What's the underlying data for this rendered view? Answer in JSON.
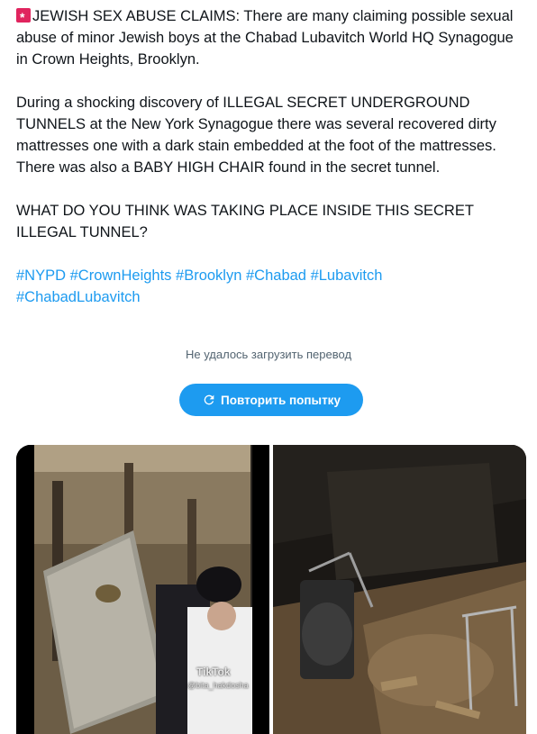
{
  "post": {
    "paragraph1": "JEWISH SEX ABUSE CLAIMS: There are many claiming possible sexual abuse of minor Jewish boys at the Chabad Lubavitch World HQ Synagogue in Crown Heights, Brooklyn.",
    "paragraph2": "During a shocking discovery of ILLEGAL SECRET UNDERGROUND TUNNELS at the New York Synagogue there was several recovered dirty mattresses one with a dark stain embedded at the foot of the mattresses. There was also a BABY HIGH CHAIR found in the secret tunnel.",
    "paragraph3": "WHAT DO YOU THINK WAS TAKING PLACE INSIDE THIS SECRET ILLEGAL TUNNEL?",
    "hashtags": [
      "#NYPD",
      "#CrownHeights",
      "#Brooklyn",
      "#Chabad",
      "#Lubavitch",
      "#ChabadLubavitch"
    ]
  },
  "translation": {
    "error_text": "Не удалось загрузить перевод",
    "retry_label": "Повторить попытку"
  },
  "media": {
    "left_watermark": "TikTok",
    "left_watermark_user": "@bita_hakdosha"
  },
  "colors": {
    "accent": "#1d9bf0",
    "text": "#0f1419",
    "muted": "#536471",
    "siren": "#e0245e"
  },
  "icons": {
    "siren": "police-light-icon",
    "retry": "refresh-icon"
  }
}
